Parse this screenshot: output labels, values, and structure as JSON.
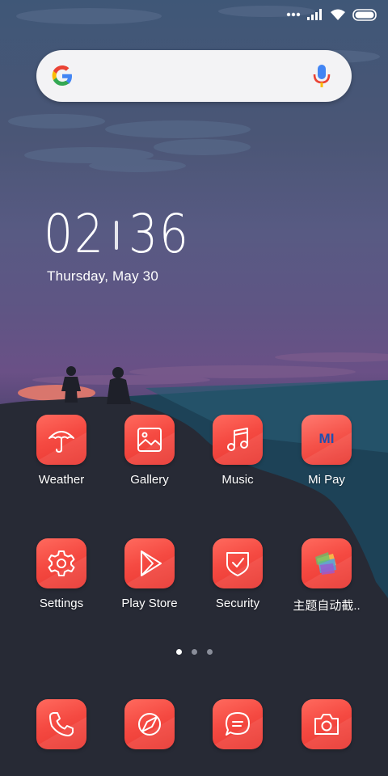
{
  "status_bar": {
    "icons": [
      "dots-icon",
      "signal-icon",
      "wifi-icon",
      "battery-icon"
    ]
  },
  "search": {
    "logo": "google-logo",
    "mic": "mic-icon"
  },
  "clock": {
    "hours": "02",
    "minutes": "36",
    "date": "Thursday, May 30"
  },
  "apps": [
    {
      "label": "Weather",
      "icon": "umbrella-icon"
    },
    {
      "label": "Gallery",
      "icon": "image-icon"
    },
    {
      "label": "Music",
      "icon": "music-note-icon"
    },
    {
      "label": "Mi Pay",
      "icon": "mi-pay-icon",
      "icon_text": "MI"
    },
    {
      "label": "Settings",
      "icon": "gear-icon"
    },
    {
      "label": "Play Store",
      "icon": "play-icon"
    },
    {
      "label": "Security",
      "icon": "shield-check-icon"
    },
    {
      "label": "主题自动截..",
      "icon": "theme-screenshot-icon"
    }
  ],
  "dock": [
    {
      "icon": "phone-icon"
    },
    {
      "icon": "browser-compass-icon"
    },
    {
      "icon": "message-bubble-icon"
    },
    {
      "icon": "camera-icon"
    }
  ],
  "page_indicator": {
    "pages": 3,
    "current": 1
  },
  "colors": {
    "icon_red": "#f54a42",
    "search_bg": "#f3f3f5"
  }
}
